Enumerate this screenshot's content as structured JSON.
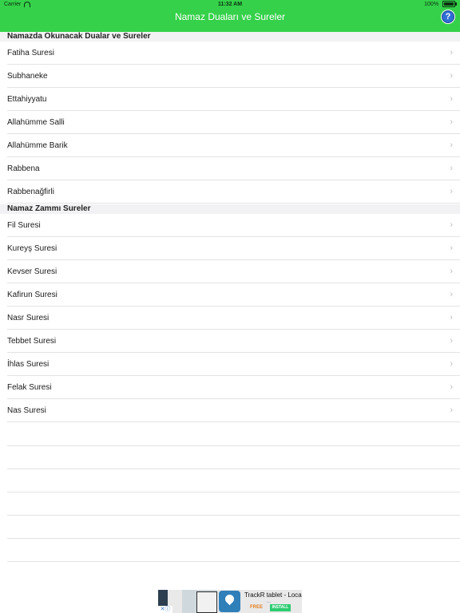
{
  "status_bar": {
    "carrier": "Carrier",
    "time": "11:32 AM",
    "battery": "100%",
    "battery_level": 1.0
  },
  "nav": {
    "title": "Namaz Duaları ve Sureler",
    "help_label": "?"
  },
  "sections": [
    {
      "title": "Namazda Okunacak Dualar ve Sureler",
      "items": [
        "Fatiha Suresi",
        "Subhaneke",
        "Ettahiyyatu",
        "Allahümme Salli",
        "Allahümme Barik",
        "Rabbena",
        "Rabbenağfirli"
      ]
    },
    {
      "title": "Namaz Zammı Sureler",
      "items": [
        "Fil Suresi",
        "Kureyş Suresi",
        "Kevser Suresi",
        "Kafirun Suresi",
        "Nasr Suresi",
        "Tebbet Suresi",
        "İhlas Suresi",
        "Felak Suresi",
        "Nas Suresi"
      ]
    }
  ],
  "chevron": "›",
  "ad": {
    "title": "TrackR tablet - Locate",
    "dots": "...",
    "free": "FREE",
    "install": "INSTALL",
    "close": "✕ⓘ"
  },
  "colors": {
    "nav_bg": "#35d14a",
    "help_bg": "#2f6fd6"
  }
}
